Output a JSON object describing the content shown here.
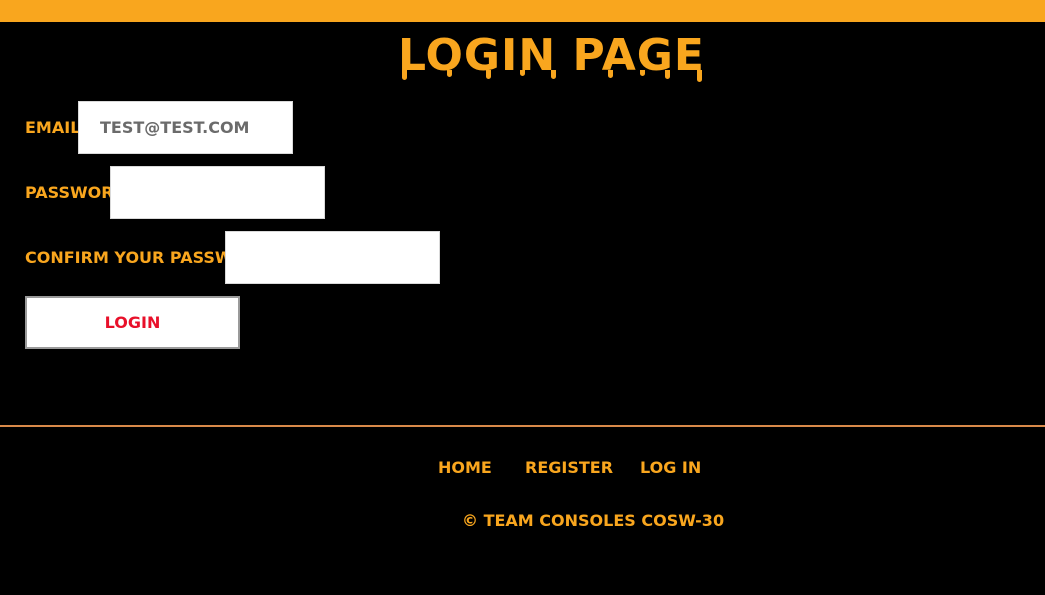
{
  "header": {
    "title": "Login Page"
  },
  "form": {
    "email_label": "Email:",
    "email_value": "test@test.com",
    "password_label": "Password:",
    "password_value": "",
    "confirm_label": "Confirm your password:",
    "confirm_value": "",
    "login_button": "Login"
  },
  "footer": {
    "links": [
      "Home",
      "Register",
      "Log In"
    ],
    "copyright": "© Team Consoles COSW-30"
  },
  "colors": {
    "accent": "#f9a61e",
    "background": "#000000",
    "button_text": "#e8102a"
  }
}
